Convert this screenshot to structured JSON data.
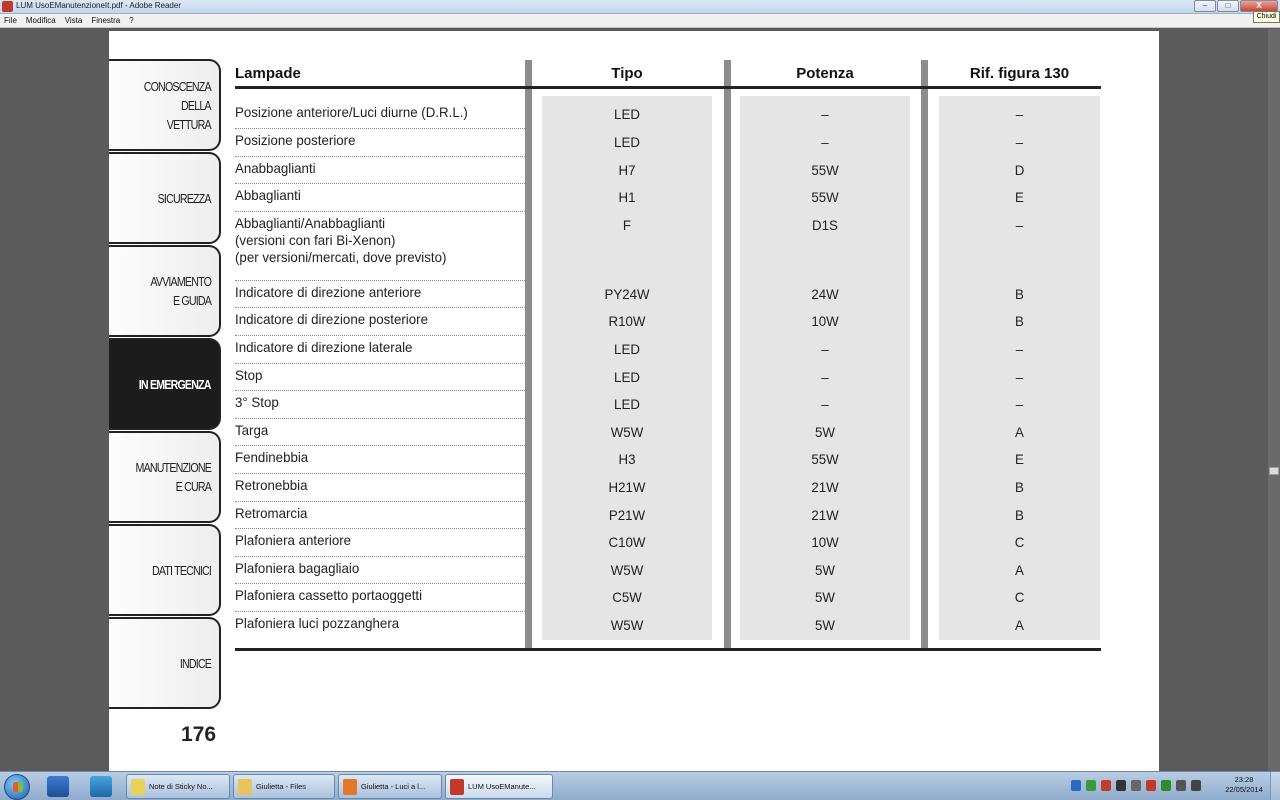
{
  "window": {
    "title": "LUM UsoEManutenzioneIt.pdf - Adobe Reader",
    "minimize": "–",
    "maximize": "□",
    "close": "X",
    "close_tooltip": "Chiudi"
  },
  "menu": [
    "File",
    "Modifica",
    "Vista",
    "Finestra",
    "?"
  ],
  "sidebar": {
    "tabs": [
      {
        "label": "CONOSCENZA\nDELLA\nVETTURA",
        "active": false
      },
      {
        "label": "SICUREZZA",
        "active": false
      },
      {
        "label": "AVVIAMENTO\nE GUIDA",
        "active": false
      },
      {
        "label": "IN EMERGENZA",
        "active": true
      },
      {
        "label": "MANUTENZIONE\nE CURA",
        "active": false
      },
      {
        "label": "DATI TECNICI",
        "active": false
      },
      {
        "label": "INDICE",
        "active": false
      }
    ],
    "page_number": "176"
  },
  "table": {
    "headers": [
      "Lampade",
      "Tipo",
      "Potenza",
      "Rif. figura 130"
    ],
    "rows": [
      {
        "name": "Posizione anteriore/Luci diurne (D.R.L.)",
        "tipo": "LED",
        "potenza": "–",
        "rif": "–"
      },
      {
        "name": "Posizione posteriore",
        "tipo": "LED",
        "potenza": "–",
        "rif": "–"
      },
      {
        "name": "Anabbaglianti",
        "tipo": "H7",
        "potenza": "55W",
        "rif": "D"
      },
      {
        "name": "Abbaglianti",
        "tipo": "H1",
        "potenza": "55W",
        "rif": "E"
      },
      {
        "name": "Abbaglianti/Anabbaglianti\n(versioni con fari Bi-Xenon)\n(per versioni/mercati, dove previsto)",
        "tipo": "F",
        "potenza": "D1S",
        "rif": "–"
      },
      {
        "name": "Indicatore di direzione anteriore",
        "tipo": "PY24W",
        "potenza": "24W",
        "rif": "B"
      },
      {
        "name": "Indicatore di direzione posteriore",
        "tipo": "R10W",
        "potenza": "10W",
        "rif": "B"
      },
      {
        "name": "Indicatore di direzione laterale",
        "tipo": "LED",
        "potenza": "–",
        "rif": "–"
      },
      {
        "name": "Stop",
        "tipo": "LED",
        "potenza": "–",
        "rif": "–"
      },
      {
        "name": "3° Stop",
        "tipo": "LED",
        "potenza": "–",
        "rif": "–"
      },
      {
        "name": "Targa",
        "tipo": "W5W",
        "potenza": "5W",
        "rif": "A"
      },
      {
        "name": "Fendinebbia",
        "tipo": "H3",
        "potenza": "55W",
        "rif": "E"
      },
      {
        "name": "Retronebbia",
        "tipo": "H21W",
        "potenza": "21W",
        "rif": "B"
      },
      {
        "name": "Retromarcia",
        "tipo": "P21W",
        "potenza": "21W",
        "rif": "B"
      },
      {
        "name": "Plafoniera anteriore",
        "tipo": "C10W",
        "potenza": "10W",
        "rif": "C"
      },
      {
        "name": "Plafoniera bagagliaio",
        "tipo": "W5W",
        "potenza": "5W",
        "rif": "A"
      },
      {
        "name": "Plafoniera cassetto portaoggetti",
        "tipo": "C5W",
        "potenza": "5W",
        "rif": "C"
      },
      {
        "name": "Plafoniera luci pozzanghera",
        "tipo": "W5W",
        "potenza": "5W",
        "rif": "A"
      }
    ]
  },
  "taskbar": {
    "buttons": [
      {
        "label": "Note di Sticky No...",
        "icon": "sticky-notes-icon",
        "color": "#e8d35a",
        "active": false
      },
      {
        "label": "Giulietta - Files",
        "icon": "folder-icon",
        "color": "#e8c45a",
        "active": false
      },
      {
        "label": "Giulietta - Luci a l...",
        "icon": "firefox-icon",
        "color": "#e2762a",
        "active": false
      },
      {
        "label": "LUM UsoEManute...",
        "icon": "pdf-icon",
        "color": "#c0392b",
        "active": true
      }
    ],
    "tray_icons": [
      "network-icon",
      "shield-icon",
      "chart-icon",
      "app-icon",
      "flag-icon",
      "antivirus-icon",
      "update-icon",
      "device-icon",
      "volume-icon"
    ],
    "clock_time": "23:28",
    "clock_date": "22/05/2014"
  }
}
